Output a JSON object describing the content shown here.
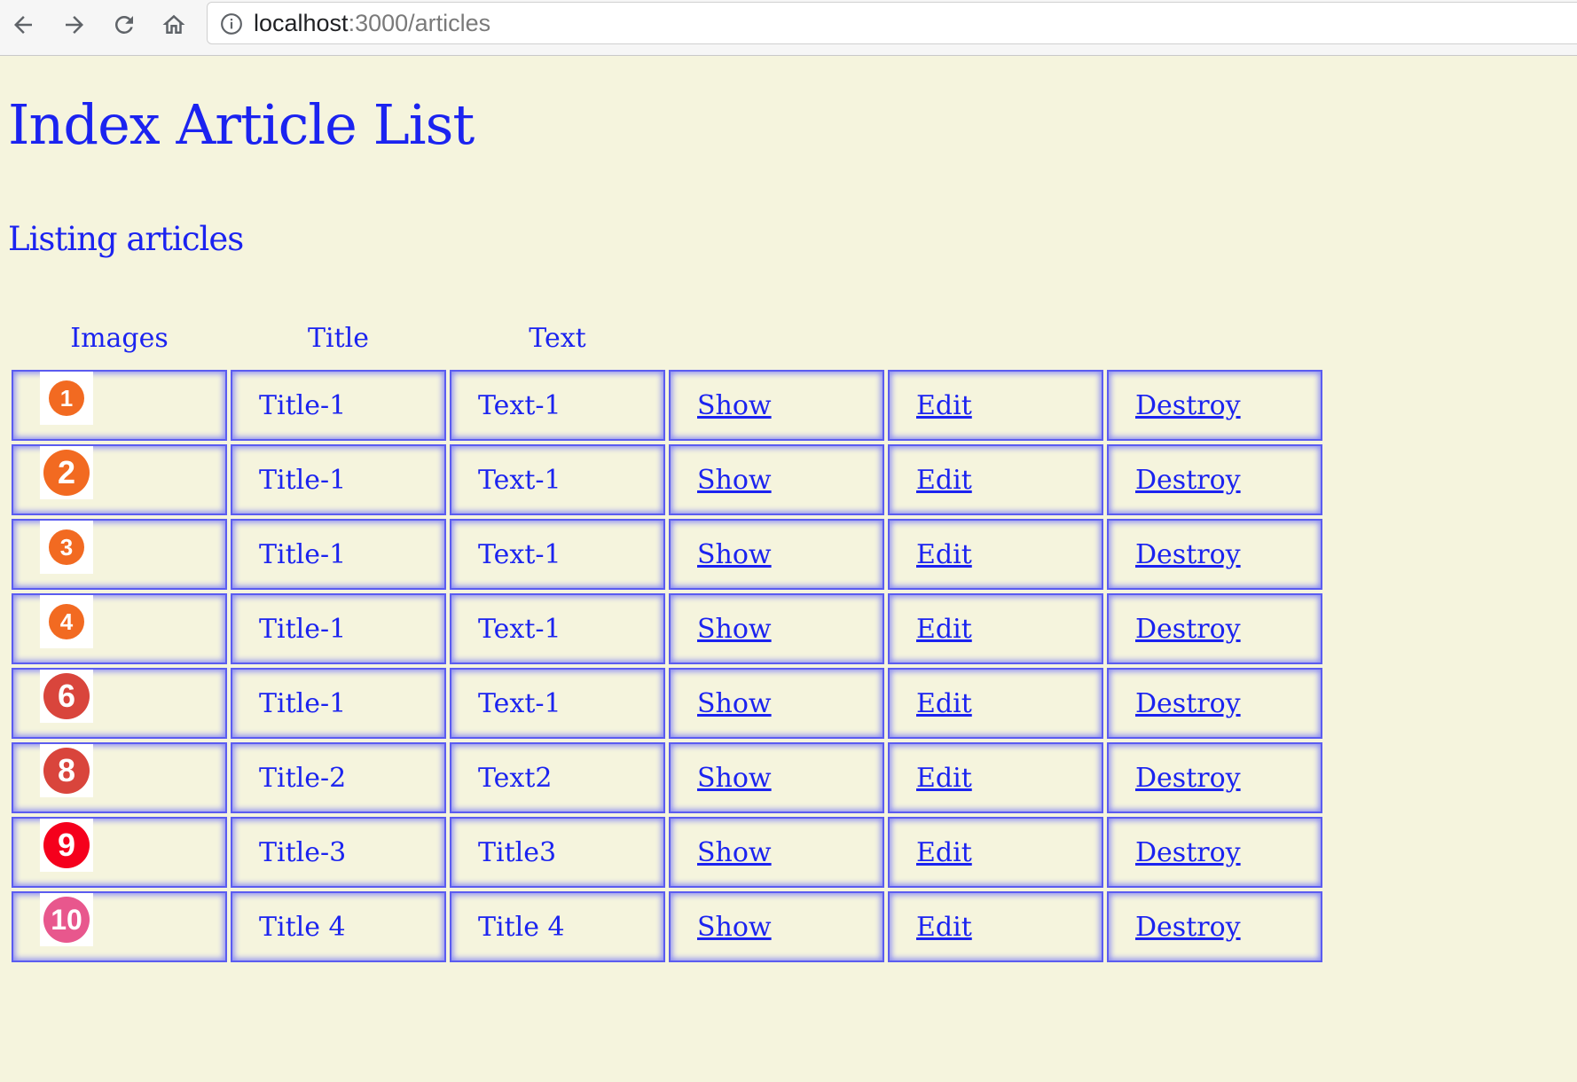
{
  "browser": {
    "url_host": "localhost",
    "url_rest": ":3000/articles"
  },
  "page": {
    "title": "Index Article List",
    "subtitle": "Listing articles"
  },
  "table": {
    "headers": [
      "Images",
      "Title",
      "Text"
    ],
    "rows": [
      {
        "badge": "1",
        "badge_color": "#f26a21",
        "badge_size": "small",
        "title": "Title-1",
        "text": "Text-1",
        "show": "Show",
        "edit": "Edit",
        "destroy": "Destroy"
      },
      {
        "badge": "2",
        "badge_color": "#f26a21",
        "badge_size": "large",
        "title": "Title-1",
        "text": "Text-1",
        "show": "Show",
        "edit": "Edit",
        "destroy": "Destroy"
      },
      {
        "badge": "3",
        "badge_color": "#f26a21",
        "badge_size": "small",
        "title": "Title-1",
        "text": "Text-1",
        "show": "Show",
        "edit": "Edit",
        "destroy": "Destroy"
      },
      {
        "badge": "4",
        "badge_color": "#f26a21",
        "badge_size": "small",
        "title": "Title-1",
        "text": "Text-1",
        "show": "Show",
        "edit": "Edit",
        "destroy": "Destroy"
      },
      {
        "badge": "6",
        "badge_color": "#d9453c",
        "badge_size": "large",
        "title": "Title-1",
        "text": "Text-1",
        "show": "Show",
        "edit": "Edit",
        "destroy": "Destroy"
      },
      {
        "badge": "8",
        "badge_color": "#d9453c",
        "badge_size": "large",
        "title": "Title-2",
        "text": "Text2",
        "show": "Show",
        "edit": "Edit",
        "destroy": "Destroy"
      },
      {
        "badge": "9",
        "badge_color": "#f5001c",
        "badge_size": "large",
        "title": "Title-3",
        "text": "Title3",
        "show": "Show",
        "edit": "Edit",
        "destroy": "Destroy"
      },
      {
        "badge": "10",
        "badge_color": "#e8578d",
        "badge_size": "large",
        "title": "Title 4",
        "text": "Title 4",
        "show": "Show",
        "edit": "Edit",
        "destroy": "Destroy"
      }
    ]
  },
  "colors": {
    "background": "#f5f4dd",
    "text": "#1b23f0",
    "cell_border": "#5b5cf0"
  }
}
